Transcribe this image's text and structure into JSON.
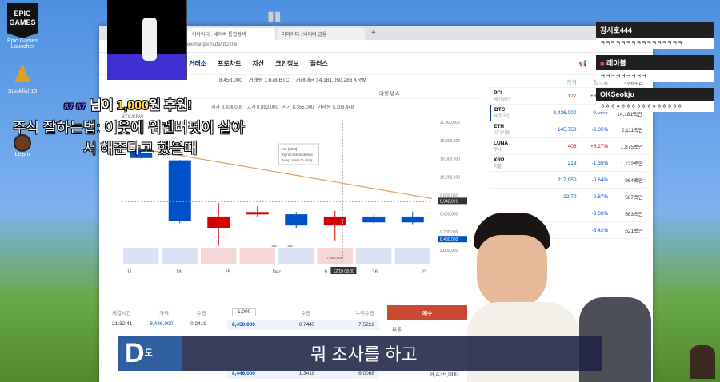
{
  "desktop": {
    "icons": [
      {
        "label": "Epic Games Launcher",
        "logo": "EPIC GAMES"
      },
      {
        "label": "Stockfish15"
      },
      {
        "label": "Leijun"
      }
    ]
  },
  "browser": {
    "tabs": [
      "이아이디 : 네이버 통합검색",
      "이아이디 : 네이버 금융"
    ],
    "url": "exchange/trade/btc/krw",
    "nav": [
      "거래소",
      "프로차트",
      "자산",
      "코인정보",
      "플러스"
    ]
  },
  "ticker": {
    "price": "8,458,000",
    "volume_label": "거래량",
    "volume": "1,678",
    "volume_unit": "BTC",
    "value_label": "거래대금",
    "value": "14,181,050,286",
    "value_unit": "KRW",
    "price_partial": "8,436,000",
    "ohlc": [
      "시가 8,436,000",
      "고가 8,893,000",
      "저가 8,355,000",
      "거래량 5,206.448"
    ],
    "tab": "마켓 뎁스"
  },
  "chart_data": {
    "type": "candlestick",
    "pair": "BTC/KRW",
    "x_labels": [
      "11",
      "18",
      "25",
      "Dec",
      "9",
      "16",
      "23"
    ],
    "y_ticks": [
      "11,000,000",
      "10,800,000",
      "10,600,000",
      "10,200,000",
      "9,800,000",
      "9,400,000",
      "9,200,000",
      "9,000,000"
    ],
    "price_tags": {
      "current": "8,942,091",
      "low": "8,430,000",
      "min": "7,980,000"
    },
    "hover_label": "12/19 08:00",
    "tooltip": [
      "Hor [33.0]",
      "Right-click to delete",
      "Swap cross to drag"
    ],
    "candles": [
      {
        "x": "11",
        "open": 10450000,
        "close": 10250000,
        "high": 10460000,
        "low": 10240000,
        "dir": "down"
      },
      {
        "x": "18",
        "open": 10200000,
        "close": 8850000,
        "high": 10210000,
        "low": 8800000,
        "dir": "down"
      },
      {
        "x": "25",
        "open": 8700000,
        "close": 8950000,
        "high": 9250000,
        "low": 8300000,
        "dir": "up"
      },
      {
        "x": "Dec",
        "open": 9000000,
        "close": 9050000,
        "high": 9180000,
        "low": 8950000,
        "dir": "up"
      },
      {
        "x": "9",
        "open": 9000000,
        "close": 8750000,
        "high": 9050000,
        "low": 8700000,
        "dir": "down"
      },
      {
        "x": "16",
        "open": 8950000,
        "close": 8750000,
        "high": 9080000,
        "low": 8420000,
        "dir": "up"
      },
      {
        "x": "20",
        "open": 8950000,
        "close": 8820000,
        "high": 9000000,
        "low": 8780000,
        "dir": "down"
      },
      {
        "x": "23",
        "open": 8950000,
        "close": 8820000,
        "high": 9060000,
        "low": 8780000,
        "dir": "down"
      }
    ]
  },
  "coins": {
    "headers": [
      "가격",
      "등락률",
      "거래대금"
    ],
    "rows": [
      {
        "symbol": "PCI",
        "name": "페이코인",
        "price": "127",
        "change": "+3.25%",
        "vol": "",
        "dir": "rise"
      },
      {
        "symbol": "BTC",
        "name": "비트코인",
        "price": "8,436,000",
        "change": "-0.26%",
        "vol": "14,181백만",
        "dir": "fall",
        "selected": true
      },
      {
        "symbol": "ETH",
        "name": "이더리움",
        "price": "145,750",
        "change": "-2.05%",
        "vol": "2,111백만",
        "dir": "fall"
      },
      {
        "symbol": "LUNA",
        "name": "루나",
        "price": "406",
        "change": "+8.27%",
        "vol": "1,875백만",
        "dir": "rise"
      },
      {
        "symbol": "XRP",
        "name": "리플",
        "price": "219",
        "change": "-1.35%",
        "vol": "1,122백만",
        "dir": "fall"
      },
      {
        "symbol": "",
        "name": "",
        "price": "217,950",
        "change": "-0.64%",
        "vol": "964백만",
        "dir": "fall"
      },
      {
        "symbol": "",
        "name": "",
        "price": "22.70",
        "change": "-0.87%",
        "vol": "587백만",
        "dir": "fall"
      },
      {
        "symbol": "",
        "name": "",
        "price": "",
        "change": "-3.03%",
        "vol": "563백만",
        "dir": "fall"
      },
      {
        "symbol": "",
        "name": "",
        "price": "",
        "change": "-3.42%",
        "vol": "521백만",
        "dir": "fall"
      }
    ]
  },
  "orderbook": {
    "trade_headers": [
      "체결시간",
      "가격",
      "수량"
    ],
    "trades": [
      {
        "time": "21:32:41",
        "price": "8,436,000",
        "qty": "0.2419"
      }
    ],
    "order_headers": [
      "수량",
      "누적수량"
    ],
    "qty_input": "1,000",
    "orders": [
      {
        "price": "8,450,000",
        "qty": "0.7445",
        "cum": "7.5222"
      },
      {
        "price": "8,446,000",
        "qty": "1.3418",
        "cum": "6.0068"
      }
    ],
    "buy_tab": "매수",
    "sell_tab": "매도",
    "label": "보유",
    "bottom_price": "8,435,000"
  },
  "chat": [
    {
      "name": "강시호444",
      "text": "ㅋㅋㅋㅋㅋㅋㅋㅋㅋㅋㅋㅋㅋㅋㅋㅋ"
    },
    {
      "name": "레이블_",
      "text": "ㅋㅋㅋㅋㅋㅋㅋㅋㅋ"
    },
    {
      "name": "OKSeokju",
      "text": "ㅎㅎㅎㅎㅎㅎㅎㅎㅎㅎㅎㅎㅎㅎㅎㅎ"
    }
  ],
  "donation": {
    "prefix": "87 87",
    "text1": "님이 ",
    "amount": "1,000",
    "text2": "원 후원!",
    "message_line1": "주식 잘하는법: 이웃에 워렌버핏이 살아",
    "message_line2": "서 해준다고 했을때"
  },
  "caption": {
    "logo": "D",
    "logo_sub": "도",
    "text": "뭐 조사를 하고"
  },
  "colors": {
    "rise": "#d60000",
    "fall": "#0051c7",
    "brand": "#093687",
    "trend": "#d9a36a"
  }
}
